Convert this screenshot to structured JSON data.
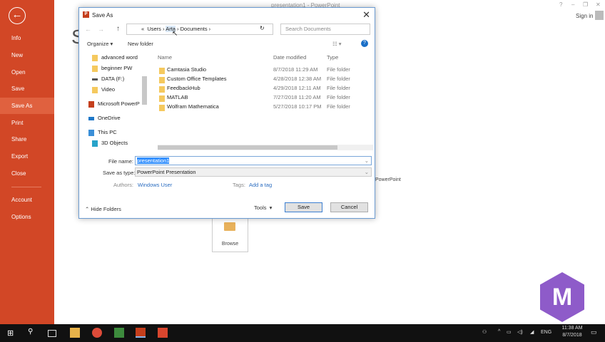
{
  "app": {
    "title": "presentation1 - PowerPoint",
    "window_buttons": [
      "?",
      "–",
      "❐",
      "✕"
    ],
    "sign_in": "Sign in",
    "bg_heading": "S",
    "browse": "Browse",
    "powerpoint_label": "PowerPoint"
  },
  "backstage": {
    "items": [
      "Info",
      "New",
      "Open",
      "Save",
      "Save As",
      "Print",
      "Share",
      "Export",
      "Close",
      "Account",
      "Options"
    ],
    "selected": "Save As",
    "accent": "#d24726"
  },
  "dialog": {
    "title": "Save As",
    "breadcrumb": [
      "«",
      "Users",
      "Arta",
      "Documents"
    ],
    "search_placeholder": "Search Documents",
    "organize": "Organize ▾",
    "new_folder": "New folder",
    "tree": [
      "advanced word",
      "beginner PW",
      "DATA (F:)",
      "Video",
      "Microsoft PowerP",
      "OneDrive",
      "This PC",
      "3D Objects"
    ],
    "columns": {
      "name": "Name",
      "date": "Date modified",
      "type": "Type"
    },
    "files": [
      {
        "name": "Camtasia Studio",
        "date": "8/7/2018 11:29 AM",
        "type": "File folder"
      },
      {
        "name": "Custom Office Templates",
        "date": "4/28/2018 12:38 AM",
        "type": "File folder"
      },
      {
        "name": "FeedbackHub",
        "date": "4/29/2018 12:11 AM",
        "type": "File folder"
      },
      {
        "name": "MATLAB",
        "date": "7/27/2018 11:20 AM",
        "type": "File folder"
      },
      {
        "name": "Wolfram Mathematica",
        "date": "5/27/2018 10:17 PM",
        "type": "File folder"
      }
    ],
    "file_name_label": "File name:",
    "file_name": "presentation1",
    "save_type_label": "Save as type:",
    "save_type": "PowerPoint Presentation",
    "authors_label": "Authors:",
    "authors": "Windows User",
    "tags_label": "Tags:",
    "tags": "Add a tag",
    "hide_folders": "Hide Folders",
    "tools": "Tools",
    "save": "Save",
    "cancel": "Cancel"
  },
  "taskbar": {
    "time": "11:38 AM",
    "date": "8/7/2018",
    "lang": "ENG"
  },
  "watermark": "M"
}
